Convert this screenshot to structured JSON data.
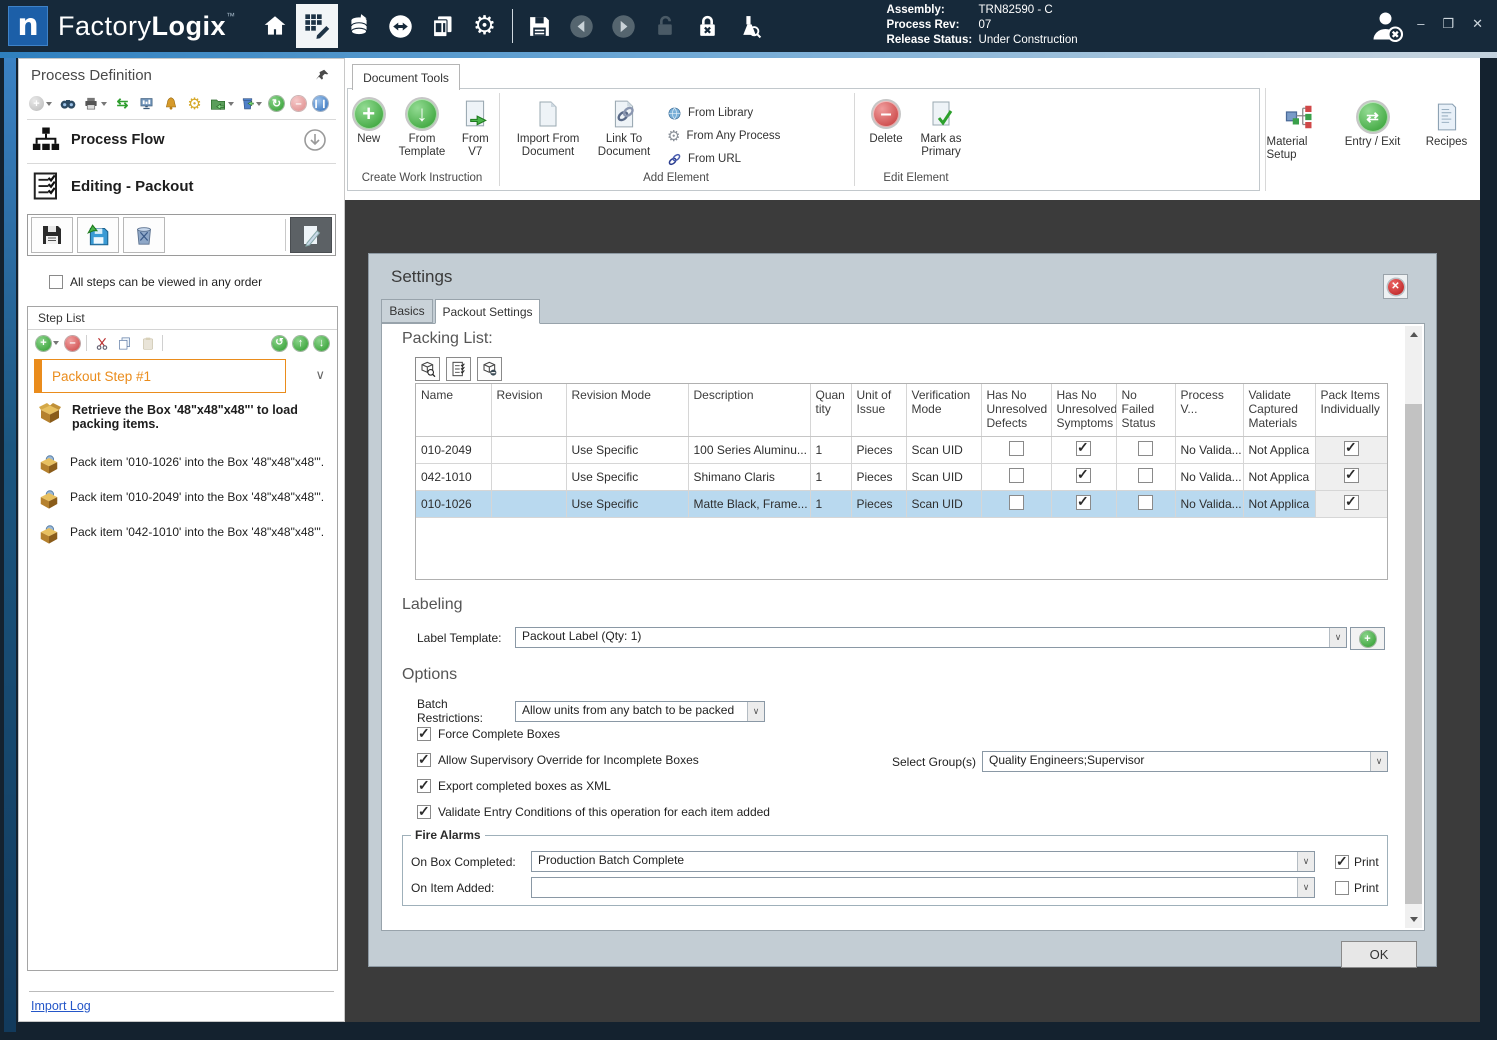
{
  "titlebar": {
    "product_name_light": "Factory",
    "product_name_bold": "Logix",
    "trademark": "™",
    "info": {
      "assembly_label": "Assembly:",
      "assembly_value": "TRN82590 - C",
      "process_rev_label": "Process Rev:",
      "process_rev_value": "07",
      "release_status_label": "Release Status:",
      "release_status_value": "Under Construction"
    },
    "window": {
      "minimize": "–",
      "maximize": "❒",
      "close": "✕"
    }
  },
  "sidebar": {
    "title": "Process Definition",
    "process_flow_label": "Process Flow",
    "editing_label": "Editing - Packout",
    "any_order": {
      "label": "All steps can be viewed in any order",
      "checked": false
    },
    "step_list": {
      "title": "Step List",
      "active_step": "Packout Step #1",
      "chevron": "∨",
      "items": [
        {
          "text": "Retrieve the Box '48\"x48\"x48\"' to load packing items.",
          "bold": true
        },
        {
          "text": "Pack item '010-1026' into the Box '48\"x48\"x48\"'.",
          "bold": false
        },
        {
          "text": "Pack item '010-2049' into the Box '48\"x48\"x48\"'.",
          "bold": false
        },
        {
          "text": "Pack item '042-1010' into the Box '48\"x48\"x48\"'.",
          "bold": false
        }
      ]
    },
    "import_log": "Import Log"
  },
  "ribbon": {
    "tab_label": "Document Tools",
    "create_group": {
      "label": "Create Work Instruction",
      "new": "New",
      "from_template": "From Template",
      "from_v7": "From V7"
    },
    "add_group": {
      "label": "Add Element",
      "import_from_document": "Import From Document",
      "link_to_document": "Link To Document",
      "from_library": "From Library",
      "from_any_process": "From Any Process",
      "from_url": "From URL"
    },
    "edit_group": {
      "label": "Edit Element",
      "delete": "Delete",
      "mark_as_primary": "Mark as Primary"
    },
    "right": {
      "material_setup": "Material Setup",
      "entry_exit": "Entry / Exit",
      "recipes": "Recipes"
    }
  },
  "dialog": {
    "title": "Settings",
    "tabs": {
      "basics": "Basics",
      "packout": "Packout Settings"
    },
    "packing_list": {
      "heading": "Packing List:",
      "columns": [
        "Name",
        "Revision",
        "Revision Mode",
        "Description",
        "Quantity",
        "Unit of Issue",
        "Verification Mode",
        "Has No Unresolved Defects",
        "Has No Unresolved Symptoms",
        "No Failed Status",
        "Process V...",
        "Validate Captured Materials",
        "Pack Items Individually"
      ],
      "rows": [
        {
          "name": "010-2049",
          "revision": "",
          "revision_mode": "Use Specific",
          "description": "100 Series Aluminu...",
          "quantity": "1",
          "unit_of_issue": "Pieces",
          "verification_mode": "Scan UID",
          "has_no_unresolved_defects": false,
          "has_no_unresolved_symptoms": true,
          "no_failed_status": false,
          "process_v": "No Valida...",
          "validate_captured_materials": "Not Applica",
          "pack_items_individually": true,
          "selected": false
        },
        {
          "name": "042-1010",
          "revision": "",
          "revision_mode": "Use Specific",
          "description": "Shimano Claris",
          "quantity": "1",
          "unit_of_issue": "Pieces",
          "verification_mode": "Scan UID",
          "has_no_unresolved_defects": false,
          "has_no_unresolved_symptoms": true,
          "no_failed_status": false,
          "process_v": "No Valida...",
          "validate_captured_materials": "Not Applica",
          "pack_items_individually": true,
          "selected": false
        },
        {
          "name": "010-1026",
          "revision": "",
          "revision_mode": "Use Specific",
          "description": "Matte Black, Frame...",
          "quantity": "1",
          "unit_of_issue": "Pieces",
          "verification_mode": "Scan UID",
          "has_no_unresolved_defects": false,
          "has_no_unresolved_symptoms": true,
          "no_failed_status": false,
          "process_v": "No Valida...",
          "validate_captured_materials": "Not Applica",
          "pack_items_individually": true,
          "selected": true
        }
      ]
    },
    "labeling": {
      "heading": "Labeling",
      "label_template_label": "Label Template:",
      "label_template_value": "Packout Label (Qty: 1)"
    },
    "options": {
      "heading": "Options",
      "batch_restrictions_label": "Batch Restrictions:",
      "batch_restrictions_value": "Allow units from any batch to be packed",
      "checkboxes": [
        {
          "label": "Force Complete Boxes",
          "checked": true
        },
        {
          "label": "Allow Supervisory Override for Incomplete Boxes",
          "checked": true
        },
        {
          "label": "Export completed boxes as XML",
          "checked": true
        },
        {
          "label": "Validate Entry Conditions of this operation for each item added",
          "checked": true
        }
      ],
      "select_groups_label": "Select Group(s)",
      "select_groups_value": "Quality Engineers;Supervisor"
    },
    "fire_alarms": {
      "legend": "Fire Alarms",
      "on_box_completed_label": "On Box Completed:",
      "on_box_completed_value": "Production Batch Complete",
      "on_box_print": {
        "label": "Print",
        "checked": true
      },
      "on_item_added_label": "On Item Added:",
      "on_item_added_value": "",
      "on_item_print": {
        "label": "Print",
        "checked": false
      }
    },
    "ok_label": "OK"
  }
}
